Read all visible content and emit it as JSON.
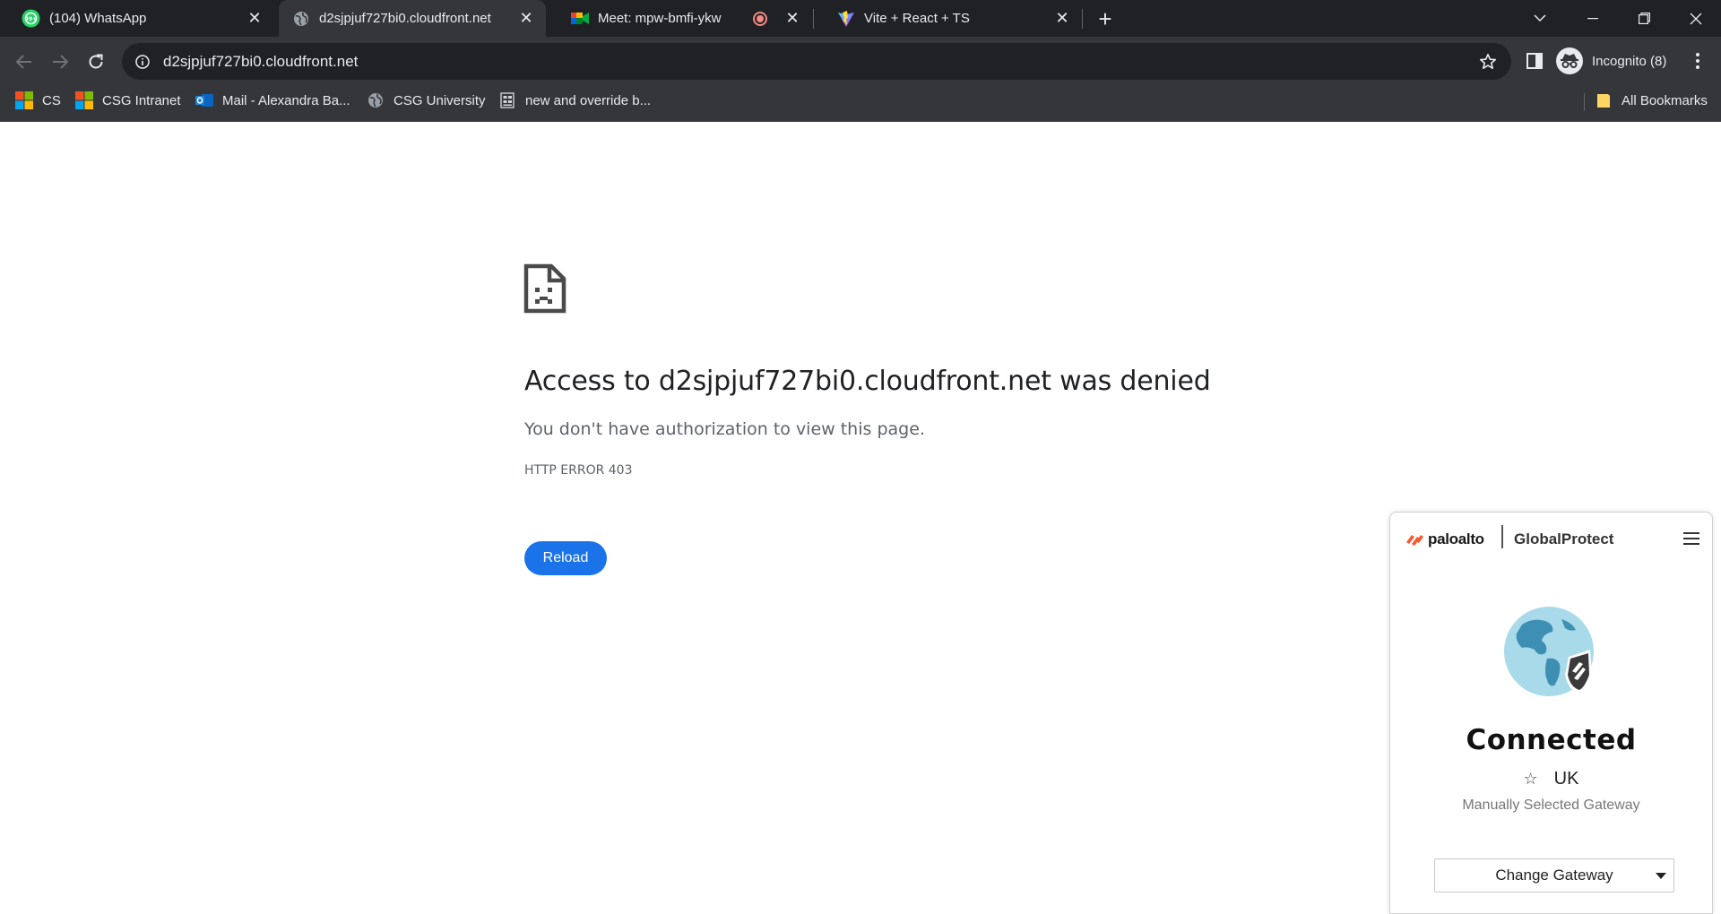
{
  "tabs": [
    {
      "title": "(104) WhatsApp",
      "favicon": "whatsapp-icon",
      "active": false
    },
    {
      "title": "d2sjpjuf727bi0.cloudfront.net",
      "favicon": "globe-icon",
      "active": true
    },
    {
      "title": "Meet: mpw-bmfi-ykw",
      "favicon": "google-meet-icon",
      "active": false,
      "recording": true
    },
    {
      "title": "Vite + React + TS",
      "favicon": "vite-icon",
      "active": false
    }
  ],
  "omnibox": {
    "url": "d2sjpjuf727bi0.cloudfront.net"
  },
  "profile": {
    "label": "Incognito (8)"
  },
  "bookmarks": [
    {
      "label": "CS",
      "icon": "microsoft-icon"
    },
    {
      "label": "CSG Intranet",
      "icon": "microsoft-icon"
    },
    {
      "label": "Mail - Alexandra Ba...",
      "icon": "outlook-icon"
    },
    {
      "label": "CSG University",
      "icon": "globe-icon"
    },
    {
      "label": "new and override b...",
      "icon": "document-icon"
    }
  ],
  "all_bookmarks": "All Bookmarks",
  "error": {
    "title": "Access to d2sjpjuf727bi0.cloudfront.net was denied",
    "description": "You don't have authorization to view this page.",
    "code": "HTTP ERROR 403",
    "reload_label": "Reload"
  },
  "globalprotect": {
    "brand": "paloalto",
    "product": "GlobalProtect",
    "status": "Connected",
    "gateway": "UK",
    "gateway_mode": "Manually Selected Gateway",
    "change_label": "Change Gateway"
  },
  "colors": {
    "tabstrip_bg": "#202124",
    "toolbar_bg": "#35363a",
    "reload_button": "#1a73e8",
    "paloalto_orange": "#fa582d"
  }
}
